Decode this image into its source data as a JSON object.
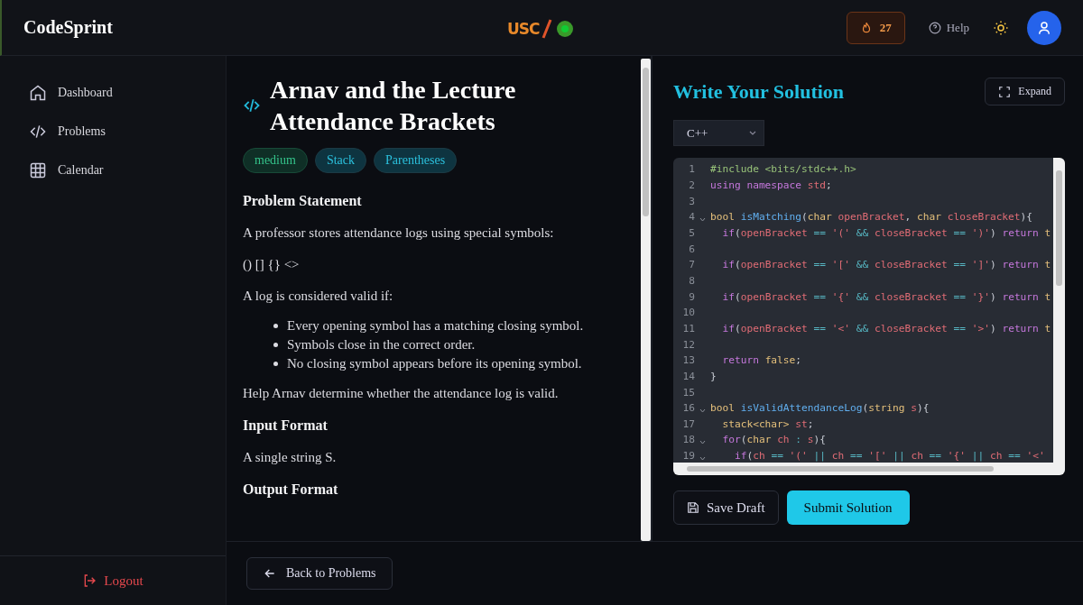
{
  "header": {
    "brand": "CodeSprint",
    "logo_text": "USC",
    "streak": "27",
    "help": "Help"
  },
  "sidebar": {
    "items": [
      {
        "label": "Dashboard"
      },
      {
        "label": "Problems"
      },
      {
        "label": "Calendar"
      }
    ],
    "logout": "Logout"
  },
  "problem": {
    "title": "Arnav and the Lecture Attendance Brackets",
    "tags": [
      {
        "label": "medium",
        "kind": "difficulty"
      },
      {
        "label": "Stack",
        "kind": "topic"
      },
      {
        "label": "Parentheses",
        "kind": "topic"
      }
    ],
    "blocks": [
      {
        "kind": "heading",
        "text": "Problem Statement"
      },
      {
        "kind": "paragraph",
        "text": "A professor stores attendance logs using special symbols:"
      },
      {
        "kind": "paragraph",
        "text": "() [] {} <>"
      },
      {
        "kind": "paragraph",
        "text": "A log is considered valid if:"
      },
      {
        "kind": "list",
        "items": [
          "Every opening symbol has a matching closing symbol.",
          "Symbols close in the correct order.",
          "No closing symbol appears before its opening symbol."
        ]
      },
      {
        "kind": "paragraph",
        "text": "Help Arnav determine whether the attendance log is valid."
      },
      {
        "kind": "heading",
        "text": "Input Format"
      },
      {
        "kind": "paragraph",
        "text": "A single string S."
      },
      {
        "kind": "heading",
        "text": "Output Format"
      }
    ]
  },
  "back_button": "Back to Problems",
  "editor": {
    "title": "Write Your Solution",
    "expand": "Expand",
    "language": "C++",
    "lines": [
      {
        "num": "1",
        "fold": false,
        "tokens": [
          {
            "t": "#include <bits/stdc++.h>",
            "kind": "pre"
          }
        ]
      },
      {
        "num": "2",
        "fold": false,
        "tokens": [
          {
            "t": "using namespace ",
            "kind": "kw"
          },
          {
            "t": "std",
            "kind": "var"
          },
          {
            "t": ";",
            "kind": "plain"
          }
        ]
      },
      {
        "num": "3",
        "fold": false
      },
      {
        "num": "4",
        "fold": true,
        "tokens": [
          {
            "t": "bool ",
            "kind": "type"
          },
          {
            "t": "isMatching",
            "kind": "fn"
          },
          {
            "t": "(",
            "kind": "plain"
          },
          {
            "t": "char ",
            "kind": "type"
          },
          {
            "t": "openBracket",
            "kind": "var"
          },
          {
            "t": ", ",
            "kind": "plain"
          },
          {
            "t": "char ",
            "kind": "type"
          },
          {
            "t": "closeBracket",
            "kind": "var"
          },
          {
            "t": "){",
            "kind": "plain"
          }
        ]
      },
      {
        "num": "5",
        "fold": false,
        "tokens": [
          {
            "t": "  if",
            "kind": "kw"
          },
          {
            "t": "(",
            "kind": "plain"
          },
          {
            "t": "openBracket ",
            "kind": "var"
          },
          {
            "t": "== ",
            "kind": "op"
          },
          {
            "t": "'(' ",
            "kind": "str"
          },
          {
            "t": "&& ",
            "kind": "op"
          },
          {
            "t": "closeBracket ",
            "kind": "var"
          },
          {
            "t": "== ",
            "kind": "op"
          },
          {
            "t": "')'",
            "kind": "str"
          },
          {
            "t": ") ",
            "kind": "plain"
          },
          {
            "t": "return ",
            "kind": "kw"
          },
          {
            "t": "t",
            "kind": "type"
          }
        ]
      },
      {
        "num": "6",
        "fold": false
      },
      {
        "num": "7",
        "fold": false,
        "tokens": [
          {
            "t": "  if",
            "kind": "kw"
          },
          {
            "t": "(",
            "kind": "plain"
          },
          {
            "t": "openBracket ",
            "kind": "var"
          },
          {
            "t": "== ",
            "kind": "op"
          },
          {
            "t": "'[' ",
            "kind": "str"
          },
          {
            "t": "&& ",
            "kind": "op"
          },
          {
            "t": "closeBracket ",
            "kind": "var"
          },
          {
            "t": "== ",
            "kind": "op"
          },
          {
            "t": "']'",
            "kind": "str"
          },
          {
            "t": ") ",
            "kind": "plain"
          },
          {
            "t": "return ",
            "kind": "kw"
          },
          {
            "t": "t",
            "kind": "type"
          }
        ]
      },
      {
        "num": "8",
        "fold": false
      },
      {
        "num": "9",
        "fold": false,
        "tokens": [
          {
            "t": "  if",
            "kind": "kw"
          },
          {
            "t": "(",
            "kind": "plain"
          },
          {
            "t": "openBracket ",
            "kind": "var"
          },
          {
            "t": "== ",
            "kind": "op"
          },
          {
            "t": "'{' ",
            "kind": "str"
          },
          {
            "t": "&& ",
            "kind": "op"
          },
          {
            "t": "closeBracket ",
            "kind": "var"
          },
          {
            "t": "== ",
            "kind": "op"
          },
          {
            "t": "'}'",
            "kind": "str"
          },
          {
            "t": ") ",
            "kind": "plain"
          },
          {
            "t": "return ",
            "kind": "kw"
          },
          {
            "t": "t",
            "kind": "type"
          }
        ]
      },
      {
        "num": "10",
        "fold": false
      },
      {
        "num": "11",
        "fold": false,
        "tokens": [
          {
            "t": "  if",
            "kind": "kw"
          },
          {
            "t": "(",
            "kind": "plain"
          },
          {
            "t": "openBracket ",
            "kind": "var"
          },
          {
            "t": "== ",
            "kind": "op"
          },
          {
            "t": "'<' ",
            "kind": "str"
          },
          {
            "t": "&& ",
            "kind": "op"
          },
          {
            "t": "closeBracket ",
            "kind": "var"
          },
          {
            "t": "== ",
            "kind": "op"
          },
          {
            "t": "'>'",
            "kind": "str"
          },
          {
            "t": ") ",
            "kind": "plain"
          },
          {
            "t": "return ",
            "kind": "kw"
          },
          {
            "t": "t",
            "kind": "type"
          }
        ]
      },
      {
        "num": "12",
        "fold": false
      },
      {
        "num": "13",
        "fold": false,
        "tokens": [
          {
            "t": "  return ",
            "kind": "kw"
          },
          {
            "t": "false",
            "kind": "type"
          },
          {
            "t": ";",
            "kind": "plain"
          }
        ]
      },
      {
        "num": "14",
        "fold": false,
        "tokens": [
          {
            "t": "}",
            "kind": "plain"
          }
        ]
      },
      {
        "num": "15",
        "fold": false
      },
      {
        "num": "16",
        "fold": true,
        "tokens": [
          {
            "t": "bool ",
            "kind": "type"
          },
          {
            "t": "isValidAttendanceLog",
            "kind": "fn"
          },
          {
            "t": "(",
            "kind": "plain"
          },
          {
            "t": "string ",
            "kind": "type"
          },
          {
            "t": "s",
            "kind": "var"
          },
          {
            "t": "){",
            "kind": "plain"
          }
        ]
      },
      {
        "num": "17",
        "fold": false,
        "tokens": [
          {
            "t": "  stack<char> ",
            "kind": "type"
          },
          {
            "t": "st",
            "kind": "var"
          },
          {
            "t": ";",
            "kind": "plain"
          }
        ]
      },
      {
        "num": "18",
        "fold": true,
        "tokens": [
          {
            "t": "  for",
            "kind": "kw"
          },
          {
            "t": "(",
            "kind": "plain"
          },
          {
            "t": "char ",
            "kind": "type"
          },
          {
            "t": "ch ",
            "kind": "var"
          },
          {
            "t": ": ",
            "kind": "op"
          },
          {
            "t": "s",
            "kind": "var"
          },
          {
            "t": "){",
            "kind": "plain"
          }
        ]
      },
      {
        "num": "19",
        "fold": true,
        "tokens": [
          {
            "t": "    if",
            "kind": "kw"
          },
          {
            "t": "(",
            "kind": "plain"
          },
          {
            "t": "ch ",
            "kind": "var"
          },
          {
            "t": "== ",
            "kind": "op"
          },
          {
            "t": "'(' ",
            "kind": "str"
          },
          {
            "t": "|| ",
            "kind": "op"
          },
          {
            "t": "ch ",
            "kind": "var"
          },
          {
            "t": "== ",
            "kind": "op"
          },
          {
            "t": "'[' ",
            "kind": "str"
          },
          {
            "t": "|| ",
            "kind": "op"
          },
          {
            "t": "ch ",
            "kind": "var"
          },
          {
            "t": "== ",
            "kind": "op"
          },
          {
            "t": "'{' ",
            "kind": "str"
          },
          {
            "t": "|| ",
            "kind": "op"
          },
          {
            "t": "ch ",
            "kind": "var"
          },
          {
            "t": "== ",
            "kind": "op"
          },
          {
            "t": "'<'",
            "kind": "str"
          }
        ]
      }
    ],
    "buttons": [
      {
        "label": "Save Draft",
        "kind": "secondary"
      },
      {
        "label": "Submit Solution",
        "kind": "primary"
      }
    ]
  }
}
